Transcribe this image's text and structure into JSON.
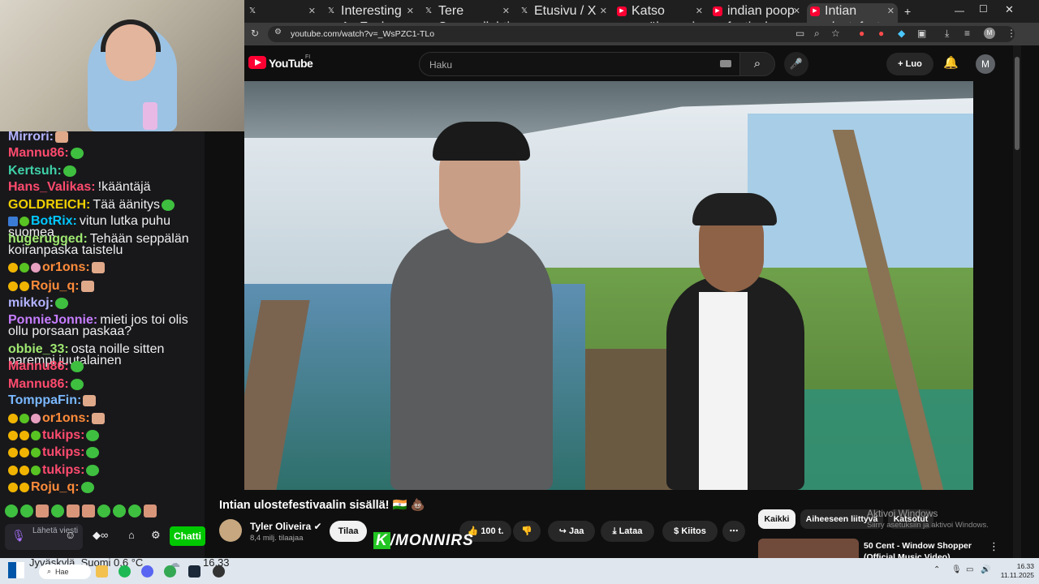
{
  "chat": {
    "messages": [
      {
        "user": "Mirrori:",
        "color": "#b3b3ff",
        "text": "",
        "emotes": [
          "face"
        ],
        "badges": []
      },
      {
        "user": "Mannu86:",
        "color": "#ff4b6e",
        "text": "",
        "emotes": [
          "green"
        ],
        "badges": []
      },
      {
        "user": "Kertsuh:",
        "color": "#3fd1a8",
        "text": "",
        "emotes": [
          "green"
        ],
        "badges": []
      },
      {
        "user": "Hans_Valikas:",
        "color": "#ff4b6e",
        "text": "!kääntäjä",
        "emotes": [],
        "badges": []
      },
      {
        "user": "GOLDREICH:",
        "color": "#f0d000",
        "text": "Tää äänitys",
        "emotes": [
          "green"
        ],
        "badges": []
      },
      {
        "user": "BotRix:",
        "color": "#00c8ff",
        "text": "vitun lutka puhu suomea",
        "emotes": [],
        "badges": [
          "blue",
          "green"
        ]
      },
      {
        "user": "hugerugged:",
        "color": "#9fe870",
        "text": "Tehään seppälän koiranpaska taistelu",
        "emotes": [],
        "badges": []
      },
      {
        "user": "or1ons:",
        "color": "#ff8c3a",
        "text": "",
        "emotes": [
          "face"
        ],
        "badges": [
          "gold",
          "green",
          "pink"
        ]
      },
      {
        "user": "Roju_q:",
        "color": "#ff8c3a",
        "text": "",
        "emotes": [
          "face"
        ],
        "badges": [
          "gold",
          "gold"
        ]
      },
      {
        "user": "mikkoj:",
        "color": "#b3b3ff",
        "text": "",
        "emotes": [
          "green"
        ],
        "badges": []
      },
      {
        "user": "PonnieJonnie:",
        "color": "#c77dff",
        "text": "mieti jos toi olis ollu porsaan paskaa?",
        "emotes": [],
        "badges": []
      },
      {
        "user": "obbie_33:",
        "color": "#9fe870",
        "text": "osta noille sitten parempi juutalainen",
        "emotes": [],
        "badges": []
      },
      {
        "user": "Mannu86:",
        "color": "#ff4b6e",
        "text": "",
        "emotes": [
          "green"
        ],
        "badges": []
      },
      {
        "user": "Mannu86:",
        "color": "#ff4b6e",
        "text": "",
        "emotes": [
          "green"
        ],
        "badges": []
      },
      {
        "user": "TomppaFin:",
        "color": "#7ab8ff",
        "text": "",
        "emotes": [
          "face"
        ],
        "badges": []
      },
      {
        "user": "or1ons:",
        "color": "#ff8c3a",
        "text": "",
        "emotes": [
          "face"
        ],
        "badges": [
          "gold",
          "green",
          "pink"
        ]
      },
      {
        "user": "tukips:",
        "color": "#ff4b6e",
        "text": "",
        "emotes": [
          "green"
        ],
        "badges": [
          "gold",
          "gold",
          "green"
        ]
      },
      {
        "user": "tukips:",
        "color": "#ff4b6e",
        "text": "",
        "emotes": [
          "green"
        ],
        "badges": [
          "gold",
          "gold",
          "green"
        ]
      },
      {
        "user": "tukips:",
        "color": "#ff4b6e",
        "text": "",
        "emotes": [
          "green"
        ],
        "badges": [
          "gold",
          "gold",
          "green"
        ]
      },
      {
        "user": "Roju_q:",
        "color": "#ff8c3a",
        "text": "",
        "emotes": [
          "green"
        ],
        "badges": [
          "gold",
          "gold"
        ]
      }
    ],
    "input_placeholder": "Lähetä viesti",
    "send_label": "Chatti"
  },
  "browser": {
    "tabs": [
      {
        "label": "",
        "icon": "x-icon"
      },
      {
        "label": "Interesting As Fuck",
        "icon": "x-icon"
      },
      {
        "label": "Tere Sammallahti",
        "icon": "x-icon"
      },
      {
        "label": "Etusivu / X",
        "icon": "x-icon"
      },
      {
        "label": "Katso myöhemmin",
        "icon": "youtube-icon"
      },
      {
        "label": "indian poop festival",
        "icon": "youtube-icon"
      },
      {
        "label": "Intian ulostefest",
        "icon": "youtube-icon"
      }
    ],
    "url": "youtube.com/watch?v=_WsPZC1-TLo"
  },
  "youtube": {
    "logo_text": "YouTube",
    "country": "FI",
    "search_placeholder": "Haku",
    "create_label": "Luo",
    "avatar_letter": "M",
    "video_title": "Intian ulostefestivaalin sisällä! 🇮🇳 💩",
    "channel_name": "Tyler Oliveira ✔",
    "subscribers": "8,4 milj. tilaajaa",
    "subscribe_label": "Tilaa",
    "like_count": "100 t.",
    "share_label": "Jaa",
    "download_label": "Lataa",
    "thanks_label": "Kiitos",
    "chips": [
      "Kaikki",
      "Aiheeseen liittyvä",
      "Katsotut"
    ],
    "recommendation_title": "50 Cent - Window Shopper (Official Music Video)",
    "activate_title": "Aktivoi Windows",
    "activate_sub": "Siirry asetuksiin ja aktivoi Windows."
  },
  "watermark": {
    "k": "K",
    "text": "/MONNIRS"
  },
  "taskbar": {
    "weather": "Jyväskylä, Suomi   0,6 °C",
    "time_overlay": "16.33",
    "search_label": "Hae",
    "time": "16.33",
    "date": "11.11.2025"
  }
}
